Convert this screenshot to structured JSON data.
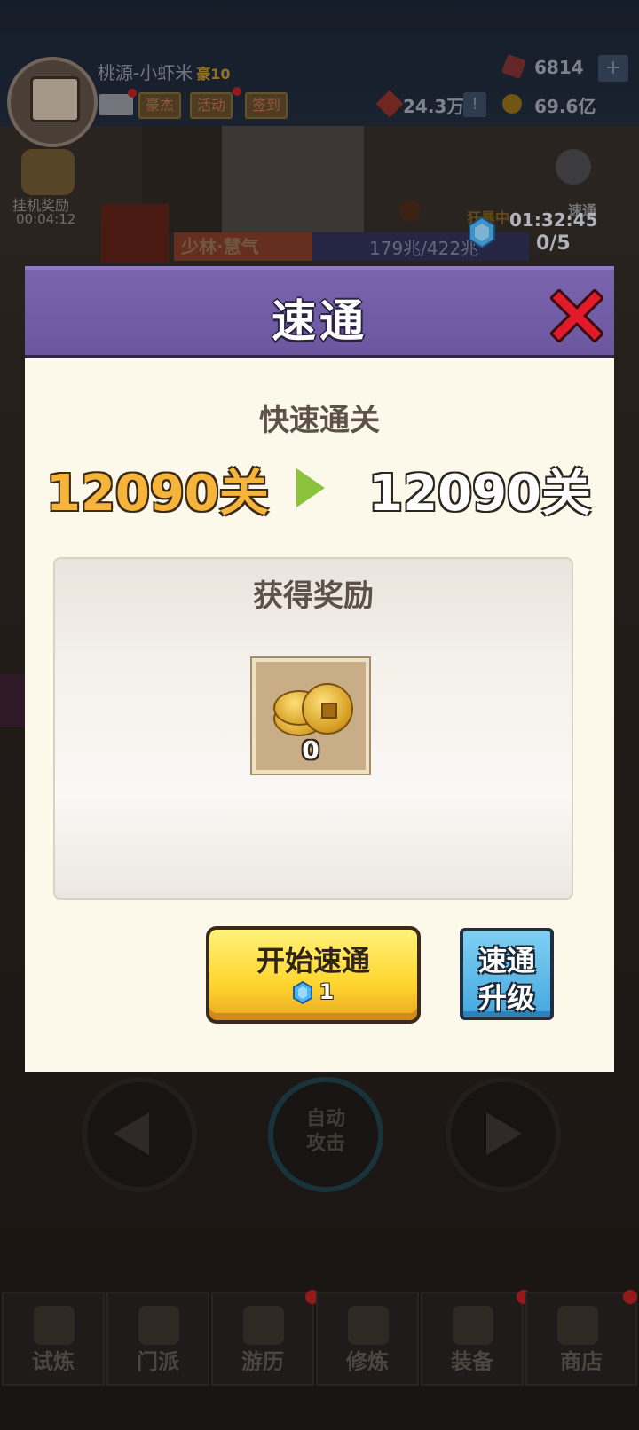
{
  "colors": {
    "header_purple": "#6c56a0",
    "body_cream": "#fcf8ea",
    "stage_from_gold": "#f6b43a",
    "arrow_green": "#8cc33c",
    "start_yellow": "#ffd52e",
    "upgrade_blue": "#46a8df",
    "close_red": "#e21b2b"
  },
  "top_bar": {
    "player_name": "桃源-小虾米",
    "vip_level": "豪10",
    "buttons": [
      "豪杰",
      "活动",
      "签到"
    ],
    "gems": "6814",
    "power": "24.3万",
    "coins": "69.6亿",
    "plus_label": "+",
    "alert_label": "!"
  },
  "scene": {
    "afk_reward_label": "挂机奖励",
    "afk_timer": "00:04:12",
    "stage_name": "少林·慧气",
    "monster_hp": "179兆/422兆",
    "frenzy_label": "狂暴中",
    "skip_timer": "01:32:45",
    "skip_count": "0/5",
    "skip_label": "速通",
    "auto_attack_line1": "自动",
    "auto_attack_line2": "攻击"
  },
  "dialog": {
    "title": "速通",
    "subtitle": "快速通关",
    "stage_from": "12090关",
    "stage_to": "12090关",
    "reward_title": "获得奖励",
    "reward_item": {
      "icon": "copper-coins-icon",
      "count": "0"
    },
    "start_button": {
      "label": "开始速通",
      "cost": "1",
      "cost_icon": "blue-gem-icon"
    },
    "upgrade_button": {
      "line1": "速通",
      "line2": "升级"
    },
    "close_icon": "close-x-icon"
  },
  "bottom_nav": {
    "items": [
      {
        "label": "试炼",
        "icon": "ninja-icon"
      },
      {
        "label": "门派",
        "icon": "temple-icon"
      },
      {
        "label": "游历",
        "icon": "mountain-icon"
      },
      {
        "label": "修炼",
        "icon": "book-icon"
      },
      {
        "label": "装备",
        "icon": "sword-icon"
      },
      {
        "label": "商店",
        "icon": "shop-icon"
      }
    ]
  }
}
